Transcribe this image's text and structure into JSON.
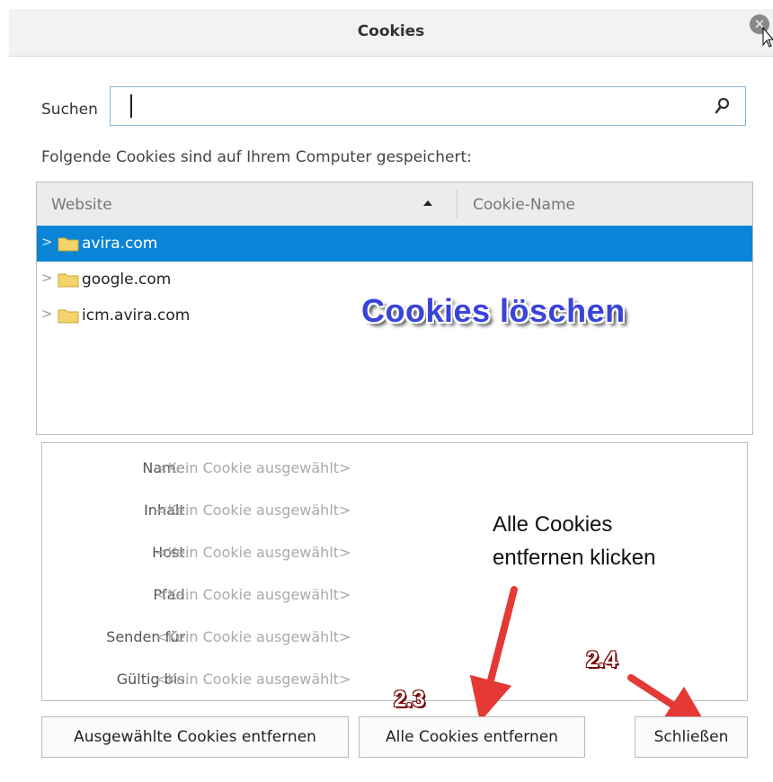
{
  "dialog": {
    "title": "Cookies"
  },
  "search": {
    "label": "Suchen",
    "value": "",
    "placeholder": ""
  },
  "hint": "Folgende Cookies sind auf Ihrem Computer gespeichert:",
  "table": {
    "columns": [
      "Website",
      "Cookie-Name"
    ],
    "sort": "ascending",
    "rows": [
      {
        "site": "avira.com",
        "selected": true
      },
      {
        "site": "google.com",
        "selected": false
      },
      {
        "site": "icm.avira.com",
        "selected": false
      }
    ]
  },
  "watermark": "Cookies löschen",
  "details": [
    {
      "label": "Name:",
      "value": "<Kein Cookie ausgewählt>"
    },
    {
      "label": "Inhalt:",
      "value": "<Kein Cookie ausgewählt>"
    },
    {
      "label": "Host:",
      "value": "<Kein Cookie ausgewählt>"
    },
    {
      "label": "Pfad:",
      "value": "<Kein Cookie ausgewählt>"
    },
    {
      "label": "Senden für:",
      "value": "<Kein Cookie ausgewählt>"
    },
    {
      "label": "Gültig bis:",
      "value": "<Kein Cookie ausgewählt>"
    }
  ],
  "annotation": {
    "line1": "Alle Cookies",
    "line2": "entfernen klicken"
  },
  "steps": {
    "s23": "2.3",
    "s24": "2.4"
  },
  "buttons": {
    "remove_selected": "Ausgewählte Cookies entfernen",
    "remove_all": "Alle Cookies entfernen",
    "close": "Schließen"
  },
  "colors": {
    "selection": "#0a84d6",
    "watermark": "#3a44d8",
    "arrow": "#e53935"
  },
  "icons": {
    "close": "close-icon",
    "search": "search-icon",
    "folder": "folder-icon",
    "expand": "chevron-right-icon"
  }
}
